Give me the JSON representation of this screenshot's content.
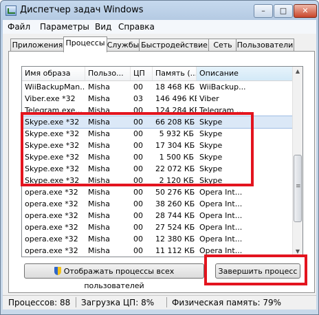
{
  "window": {
    "title": "Диспетчер задач Windows",
    "min_glyph": "–",
    "max_glyph": "□",
    "close_glyph": "✕"
  },
  "menu": [
    "Файл",
    "Параметры",
    "Вид",
    "Справка"
  ],
  "tabs": [
    "Приложения",
    "Процессы",
    "Службы",
    "Быстродействие",
    "Сеть",
    "Пользователи"
  ],
  "active_tab": "Процессы",
  "columns": [
    "Имя образа",
    "Пользо...",
    "ЦП",
    "Память (...",
    "Описание"
  ],
  "sorted_column": "Описание",
  "rows": [
    [
      "WiiBackupMan...",
      "Misha",
      "00",
      "18 468 КБ",
      "WiiBackup..."
    ],
    [
      "Viber.exe *32",
      "Misha",
      "03",
      "146 496 КБ",
      "Viber"
    ],
    [
      "Telegram.exe...",
      "Misha",
      "00",
      "124 284 КБ",
      "Telegram ..."
    ],
    [
      "Skype.exe *32",
      "Misha",
      "00",
      "66 208 КБ",
      "Skype"
    ],
    [
      "Skype.exe *32",
      "Misha",
      "00",
      "5 932 КБ",
      "Skype"
    ],
    [
      "Skype.exe *32",
      "Misha",
      "00",
      "17 304 КБ",
      "Skype"
    ],
    [
      "Skype.exe *32",
      "Misha",
      "00",
      "1 500 КБ",
      "Skype"
    ],
    [
      "Skype.exe *32",
      "Misha",
      "00",
      "22 072 КБ",
      "Skype"
    ],
    [
      "Skype.exe *32",
      "Misha",
      "00",
      "2 120 КБ",
      "Skype"
    ],
    [
      "opera.exe *32",
      "Misha",
      "00",
      "50 276 КБ",
      "Opera Int..."
    ],
    [
      "opera.exe *32",
      "Misha",
      "00",
      "38 260 КБ",
      "Opera Int..."
    ],
    [
      "opera.exe *32",
      "Misha",
      "00",
      "28 744 КБ",
      "Opera Int..."
    ],
    [
      "opera.exe *32",
      "Misha",
      "00",
      "27 524 КБ",
      "Opera Int..."
    ],
    [
      "opera.exe *32",
      "Misha",
      "00",
      "12 380 КБ",
      "Opera Int..."
    ],
    [
      "opera.exe *32",
      "Misha",
      "00",
      "11 112 КБ",
      "Opera Int..."
    ]
  ],
  "selected_row": 3,
  "buttons": {
    "show_all": "Отображать процессы всех пользователей",
    "end_process": "Завершить процесс"
  },
  "status": {
    "processes": "Процессов: 88",
    "cpu": "Загрузка ЦП: 8%",
    "memory": "Физическая память: 79%"
  },
  "colors": {
    "highlight": "#e3141e",
    "selection": "#dbe8f7"
  },
  "icons": {
    "shield": "uac-shield-icon",
    "app": "task-manager-icon"
  }
}
